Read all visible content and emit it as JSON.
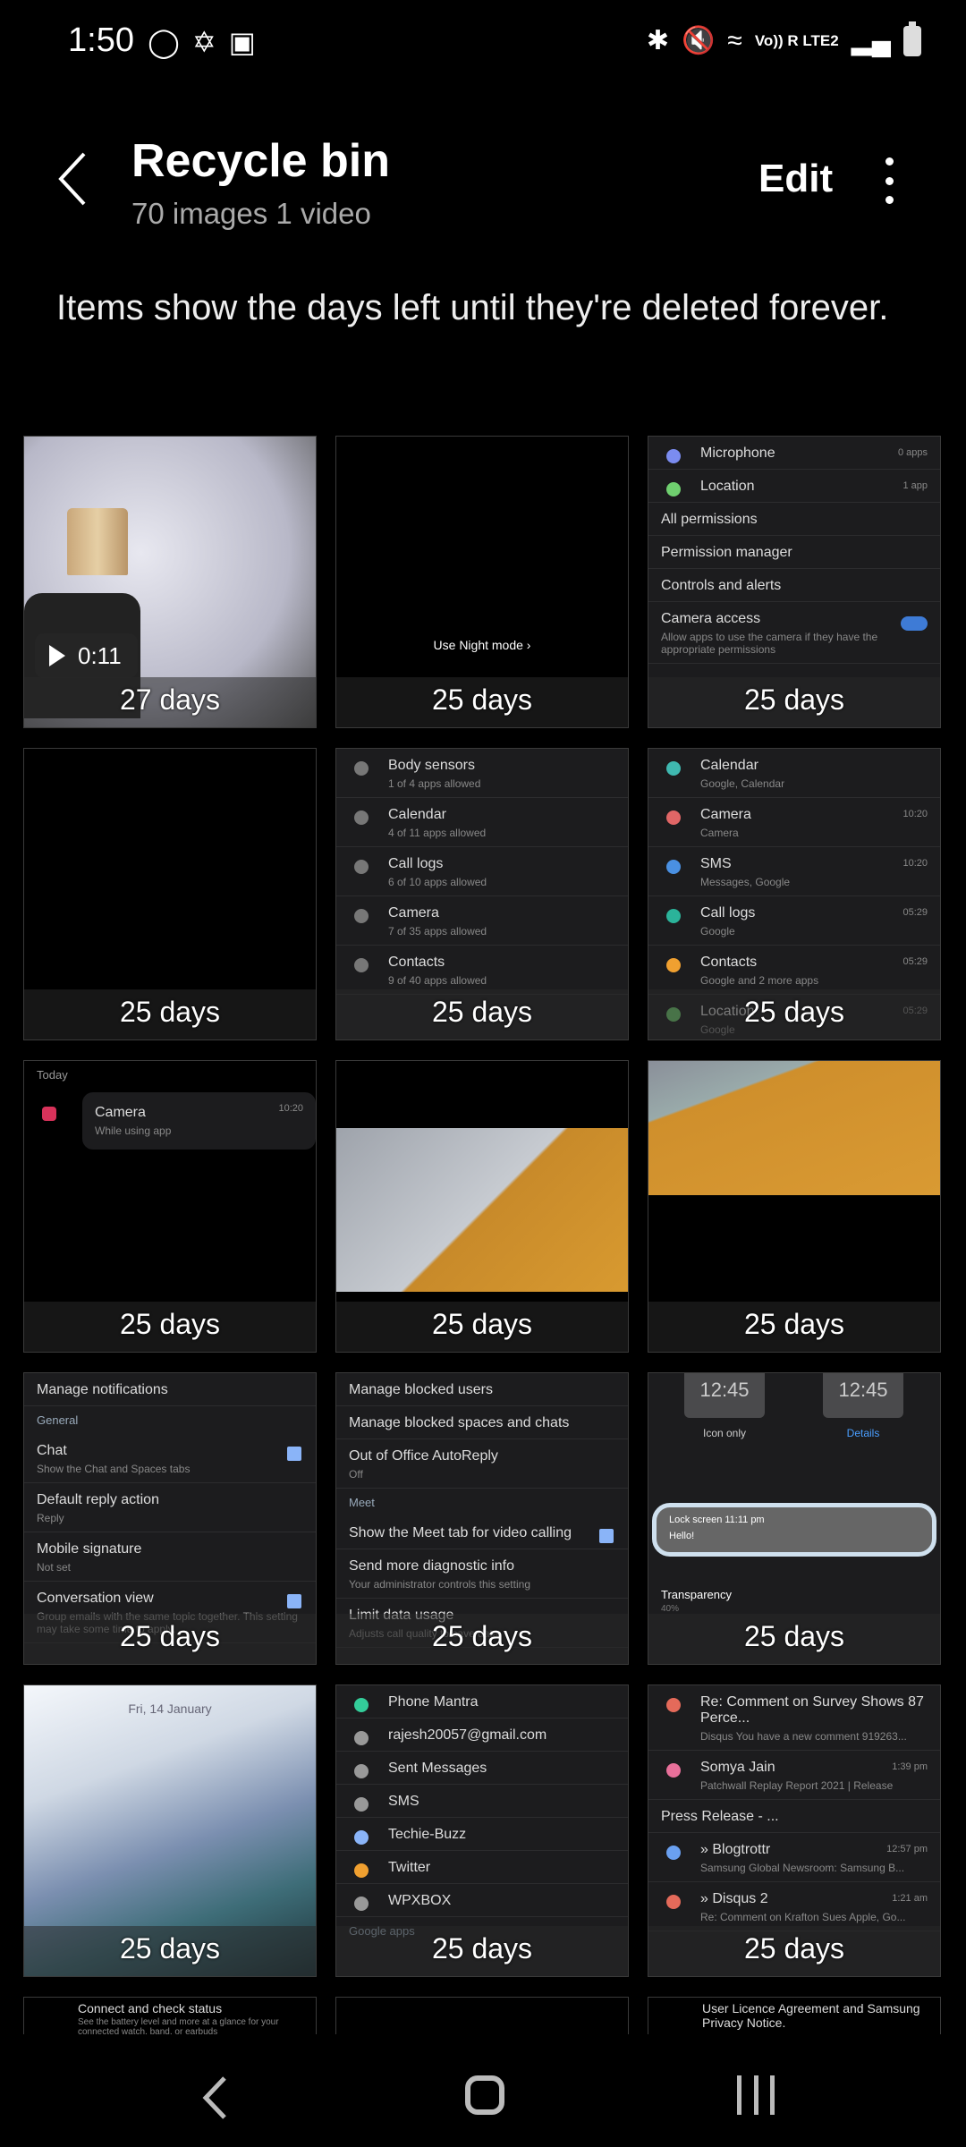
{
  "status_bar": {
    "time": "1:50",
    "network": "Vo)) R LTE2",
    "left_icons": [
      "instagram-icon",
      "slack-icon",
      "gallery-icon"
    ],
    "right_icons": [
      "bluetooth-icon",
      "mute-icon",
      "wifi-icon",
      "signal-icon",
      "battery-icon"
    ]
  },
  "header": {
    "title": "Recycle bin",
    "subtitle": "70 images 1 video",
    "edit_label": "Edit"
  },
  "info_text": "Items show the days left until they're deleted forever.",
  "tiles": [
    {
      "kind": "lamp",
      "video_duration": "0:11",
      "days": "27 days"
    },
    {
      "kind": "night",
      "caption": "Use Night mode  ›",
      "days": "25 days"
    },
    {
      "kind": "rows",
      "days": "25 days",
      "rows": [
        {
          "t": "Microphone",
          "m": "0 apps",
          "c": "#7b8cf0"
        },
        {
          "t": "Location",
          "m": "1 app",
          "c": "#6fcf6f"
        },
        {
          "t": "All permissions"
        },
        {
          "t": "Permission manager"
        },
        {
          "t": "Controls and alerts"
        },
        {
          "t": "Camera access",
          "s": "Allow apps to use the camera if they have the appropriate permissions",
          "toggle": true
        }
      ]
    },
    {
      "kind": "black",
      "days": "25 days"
    },
    {
      "kind": "rows",
      "days": "25 days",
      "rows": [
        {
          "t": "Body sensors",
          "s": "1 of 4 apps allowed",
          "c": "#777"
        },
        {
          "t": "Calendar",
          "s": "4 of 11 apps allowed",
          "c": "#777"
        },
        {
          "t": "Call logs",
          "s": "6 of 10 apps allowed",
          "c": "#777"
        },
        {
          "t": "Camera",
          "s": "7 of 35 apps allowed",
          "c": "#777"
        },
        {
          "t": "Contacts",
          "s": "9 of 40 apps allowed",
          "c": "#777"
        }
      ]
    },
    {
      "kind": "rows",
      "days": "25 days",
      "rows": [
        {
          "t": "Calendar",
          "s": "Google, Calendar",
          "c": "#3fb8b0"
        },
        {
          "t": "Camera",
          "s": "Camera",
          "m": "10:20",
          "c": "#e06666"
        },
        {
          "t": "SMS",
          "s": "Messages, Google",
          "m": "10:20",
          "c": "#4a90e2"
        },
        {
          "t": "Call logs",
          "s": "Google",
          "m": "05:29",
          "c": "#2bb39a"
        },
        {
          "t": "Contacts",
          "s": "Google and 2 more apps",
          "m": "05:29",
          "c": "#f0a030"
        },
        {
          "t": "Location",
          "s": "Google",
          "m": "05:29",
          "c": "#6fcf6f"
        }
      ]
    },
    {
      "kind": "today",
      "head": "Today",
      "days": "25 days",
      "rows": [
        {
          "t": "Camera",
          "s": "While using app",
          "m": "10:20",
          "c": "#d8325a"
        }
      ]
    },
    {
      "kind": "laptop",
      "days": "25 days"
    },
    {
      "kind": "box",
      "days": "25 days"
    },
    {
      "kind": "rows",
      "days": "25 days",
      "rows": [
        {
          "t": "Manage notifications"
        },
        {
          "h": "General"
        },
        {
          "t": "Chat",
          "s": "Show the Chat and Spaces tabs",
          "check": true
        },
        {
          "t": "Default reply action",
          "s": "Reply"
        },
        {
          "t": "Mobile signature",
          "s": "Not set"
        },
        {
          "t": "Conversation view",
          "s": "Group emails with the same topic together. This setting may take some time to apply.",
          "check": true
        }
      ]
    },
    {
      "kind": "rows",
      "days": "25 days",
      "rows": [
        {
          "t": "Manage blocked users"
        },
        {
          "t": "Manage blocked spaces and chats"
        },
        {
          "t": "Out of Office AutoReply",
          "s": "Off"
        },
        {
          "h": "Meet"
        },
        {
          "t": "Show the Meet tab for video calling",
          "check": true
        },
        {
          "t": "Send more diagnostic info",
          "s": "Your administrator controls this setting"
        },
        {
          "t": "Limit data usage",
          "s": "Adjusts call quality to save data"
        }
      ]
    },
    {
      "kind": "lockscreen",
      "days": "25 days",
      "clock": "12:45",
      "opt1": "Icon only",
      "opt2": "Details",
      "notif_title": "Lock screen  11:11 pm",
      "notif_body": "Hello!",
      "transparency": "Transparency",
      "transparency_value": "40%"
    },
    {
      "kind": "wall",
      "date": "Fri, 14 January",
      "days": "25 days"
    },
    {
      "kind": "rows",
      "days": "25 days",
      "rows": [
        {
          "t": "Phone Mantra",
          "c": "#3c9"
        },
        {
          "t": "rajesh20057@gmail.com",
          "c": "#999"
        },
        {
          "t": "Sent Messages",
          "c": "#999"
        },
        {
          "t": "SMS",
          "c": "#999"
        },
        {
          "t": "Techie-Buzz",
          "c": "#8ab4f8"
        },
        {
          "t": "Twitter",
          "c": "#f0a030"
        },
        {
          "t": "WPXBOX",
          "c": "#999"
        },
        {
          "h": "Google apps"
        }
      ]
    },
    {
      "kind": "rows",
      "days": "25 days",
      "rows": [
        {
          "t": "Re: Comment on Survey Shows 87 Perce...",
          "s": "Disqus You have a new comment 919263...",
          "c": "#e46a5a"
        },
        {
          "t": "Somya Jain",
          "s": "Patchwall Replay Report 2021 | Release",
          "m": "1:39 pm",
          "c": "#e8709a"
        },
        {
          "t": "Press Release - ..."
        },
        {
          "t": "» Blogtrottr",
          "s": "Samsung Global Newsroom: Samsung B...",
          "m": "12:57 pm",
          "c": "#6aa0f0"
        },
        {
          "t": "» Disqus 2",
          "s": "Re: Comment on Krafton Sues Apple, Go...",
          "m": "1:21 am",
          "c": "#e46a5a"
        }
      ]
    },
    {
      "kind": "rows",
      "days": "",
      "rows": [
        {
          "t": "Connect and check status",
          "s": "See the battery level and more at a glance for your connected watch, band, or earbuds"
        }
      ],
      "white": true
    },
    {
      "kind": "black",
      "days": ""
    },
    {
      "kind": "rows",
      "days": "",
      "rows": [
        {
          "t": "User Licence Agreement and Samsung Privacy Notice."
        }
      ],
      "white": true
    }
  ]
}
